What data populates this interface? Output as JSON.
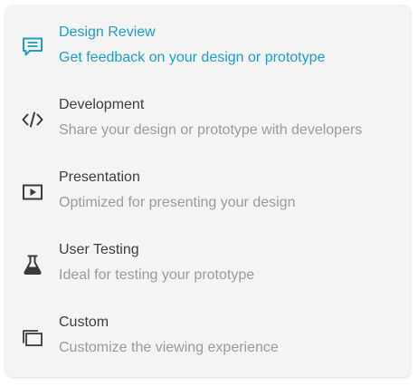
{
  "colors": {
    "accent": "#1aa0c7",
    "title": "#3d3d3d",
    "description": "#9a9a9a",
    "icon": "#3a3a3a",
    "background": "#f4f4f4"
  },
  "menu": {
    "selected_index": 0,
    "items": [
      {
        "icon": "comment-icon",
        "title": "Design Review",
        "description": "Get feedback on your design or prototype"
      },
      {
        "icon": "code-icon",
        "title": "Development",
        "description": "Share your design or prototype with developers"
      },
      {
        "icon": "play-icon",
        "title": "Presentation",
        "description": "Optimized for presenting your design"
      },
      {
        "icon": "flask-icon",
        "title": "User Testing",
        "description": "Ideal for testing your prototype"
      },
      {
        "icon": "windows-icon",
        "title": "Custom",
        "description": "Customize the viewing experience"
      }
    ]
  }
}
